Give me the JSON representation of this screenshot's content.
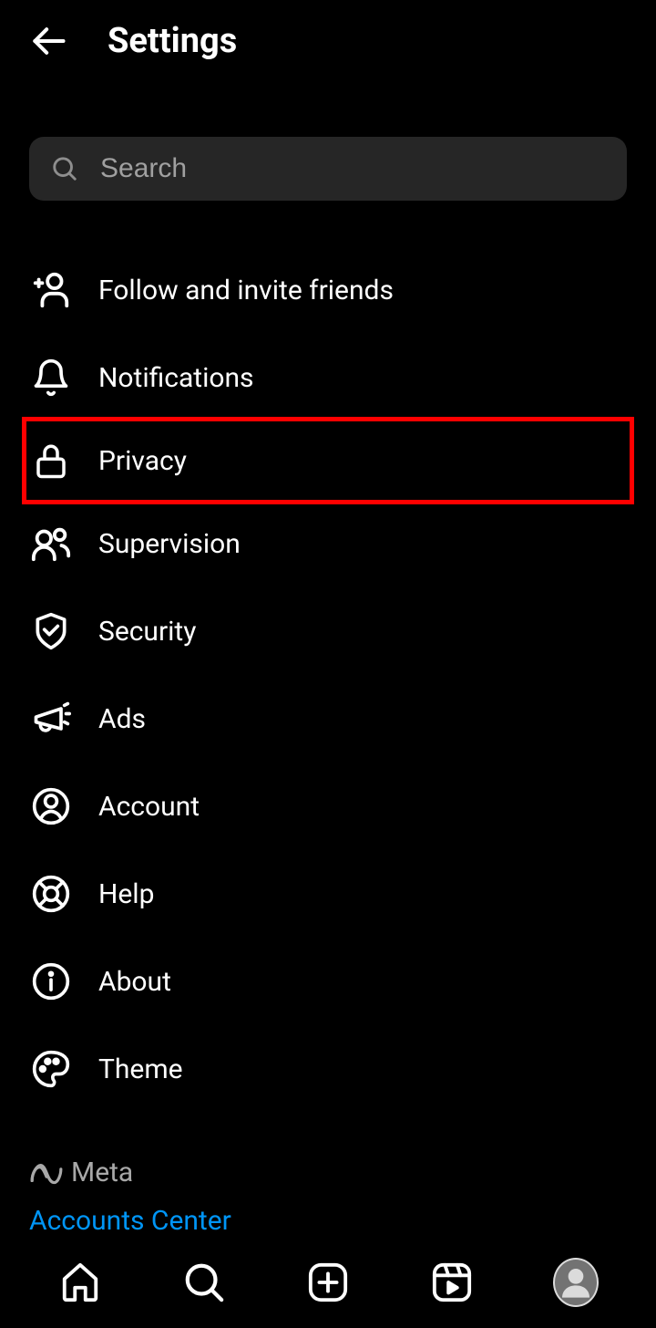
{
  "header": {
    "title": "Settings"
  },
  "search": {
    "placeholder": "Search",
    "value": ""
  },
  "menu": {
    "items": [
      {
        "label": "Follow and invite friends",
        "icon": "add-user"
      },
      {
        "label": "Notifications",
        "icon": "bell"
      },
      {
        "label": "Privacy",
        "icon": "lock",
        "highlighted": true
      },
      {
        "label": "Supervision",
        "icon": "people"
      },
      {
        "label": "Security",
        "icon": "shield"
      },
      {
        "label": "Ads",
        "icon": "megaphone"
      },
      {
        "label": "Account",
        "icon": "account"
      },
      {
        "label": "Help",
        "icon": "lifesaver"
      },
      {
        "label": "About",
        "icon": "info"
      },
      {
        "label": "Theme",
        "icon": "palette"
      }
    ]
  },
  "footer": {
    "brand": "Meta",
    "link": "Accounts Center"
  }
}
